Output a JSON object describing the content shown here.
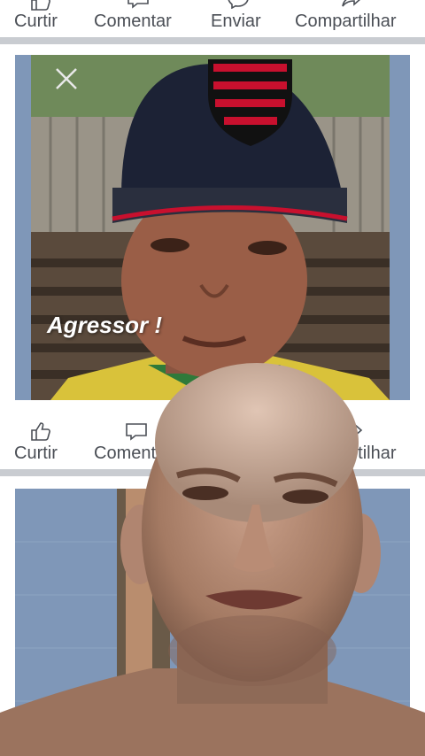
{
  "top_actions": {
    "like": "Curtir",
    "comment": "Comentar",
    "send": "Enviar",
    "share": "Compartilhar"
  },
  "bottom_actions": {
    "like": "Curtir",
    "comment": "Comentar",
    "share": "Compartilhar"
  },
  "post1": {
    "overlay_text": "Agressor !"
  },
  "icons": [
    "like-icon",
    "comment-icon",
    "messenger-icon",
    "share-icon",
    "close-icon"
  ],
  "colors": {
    "action_text": "#4b4f56",
    "separator": "#c9ccd1",
    "post_bg": "#7f97b8",
    "cap_navy": "#1c2235",
    "cap_red": "#c8102e"
  }
}
